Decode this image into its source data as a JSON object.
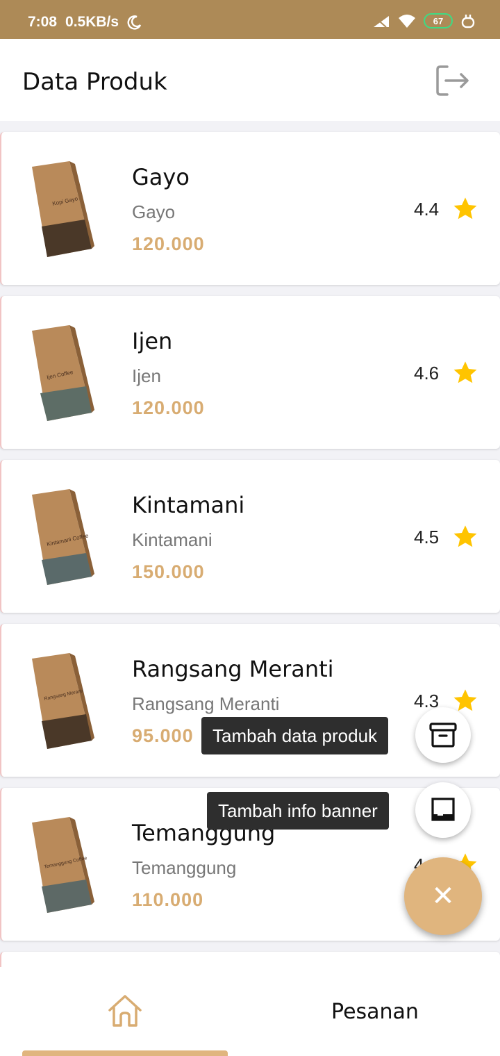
{
  "status_bar": {
    "time": "7:08",
    "speed": "0.5KB/s",
    "battery": "67"
  },
  "app_bar": {
    "title": "Data Produk"
  },
  "products": [
    {
      "name": "Gayo",
      "subtitle": "Gayo",
      "price": "120.000",
      "rating": "4.4",
      "bag_label": "Kopi Gayo"
    },
    {
      "name": "Ijen",
      "subtitle": "Ijen",
      "price": "120.000",
      "rating": "4.6",
      "bag_label": "Ijen Coffee"
    },
    {
      "name": "Kintamani",
      "subtitle": "Kintamani",
      "price": "150.000",
      "rating": "4.5",
      "bag_label": "Kintamani Coffee"
    },
    {
      "name": "Rangsang Meranti",
      "subtitle": "Rangsang Meranti",
      "price": "95.000",
      "rating": "4.3",
      "bag_label": "Rangsang Meranti"
    },
    {
      "name": "Temanggung",
      "subtitle": "Temanggung",
      "price": "110.000",
      "rating": "4.6",
      "bag_label": "Temanggung Coffee"
    }
  ],
  "speed_dial": {
    "add_product_label": "Tambah data produk",
    "add_banner_label": "Tambah info banner",
    "close_symbol": "✕"
  },
  "bottom_nav": {
    "orders_label": "Pesanan"
  },
  "colors": {
    "status_bar": "#ad8a57",
    "accent": "#e0b57e",
    "price": "#d8ac72",
    "star": "#ffc400"
  },
  "icons": {
    "logout": "logout-icon",
    "star": "star-icon",
    "box": "archive-box-icon",
    "banner": "banner-icon",
    "home": "home-icon",
    "close": "close-icon"
  }
}
